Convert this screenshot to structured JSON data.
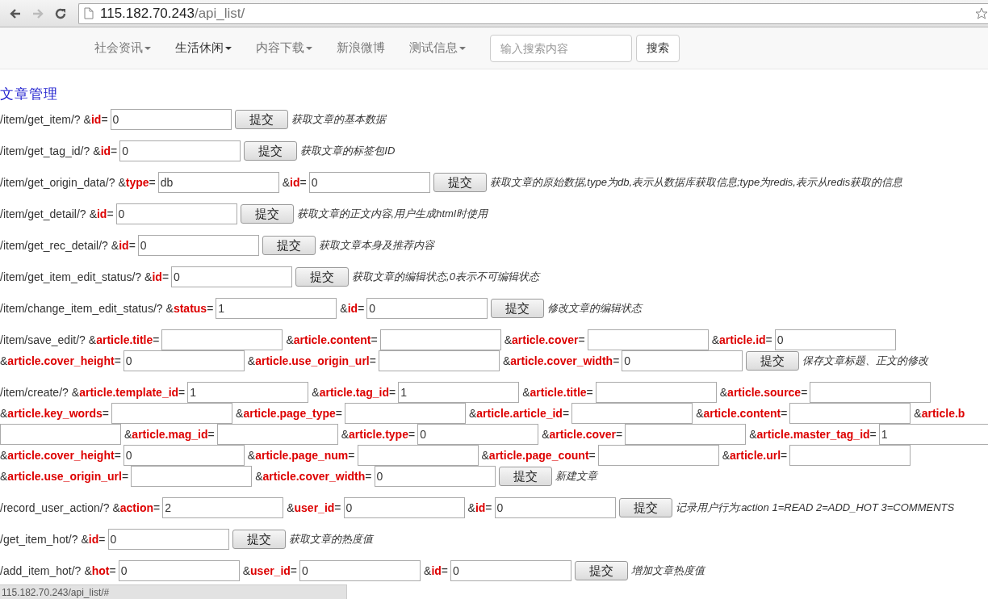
{
  "browser": {
    "url_host": "115.182.70.243",
    "url_path": "/api_list/",
    "status_text": "115.182.70.243/api_list/#"
  },
  "navbar": {
    "items": [
      {
        "label": "社会资讯",
        "dropdown": true,
        "selected": false
      },
      {
        "label": "生活休闲",
        "dropdown": true,
        "selected": true
      },
      {
        "label": "内容下载",
        "dropdown": true,
        "selected": false
      },
      {
        "label": "新浪微博",
        "dropdown": false,
        "selected": false
      },
      {
        "label": "测试信息",
        "dropdown": true,
        "selected": false
      }
    ],
    "search": {
      "placeholder": "输入搜索内容",
      "button": "搜索"
    }
  },
  "heading": "文章管理",
  "sections": [
    {
      "path": "/item/get_item/?",
      "params": [
        {
          "label": "&**id**=",
          "value": "0"
        }
      ],
      "button": "提交",
      "description": "获取文章的基本数据"
    },
    {
      "path": "/item/get_tag_id/?",
      "params": [
        {
          "label": "&**id**=",
          "value": "0"
        }
      ],
      "button": "提交",
      "description": "获取文章的标签包ID"
    },
    {
      "path": "/item/get_origin_data/?",
      "params": [
        {
          "label": "&**type**=",
          "value": "db"
        },
        {
          "label": "&**id**=",
          "value": "0"
        }
      ],
      "button": "提交",
      "description": "获取文章的原始数据,type为db,表示从数据库获取信息;type为redis,表示从redis获取的信息"
    },
    {
      "path": "/item/get_detail/?",
      "params": [
        {
          "label": "&**id**=",
          "value": "0"
        }
      ],
      "button": "提交",
      "description": "获取文章的正文内容,用户生成html时使用"
    },
    {
      "path": "/item/get_rec_detail/?",
      "params": [
        {
          "label": "&**id**=",
          "value": "0"
        }
      ],
      "button": "提交",
      "description": "获取文章本身及推荐内容"
    },
    {
      "path": "/item/get_item_edit_status/?",
      "params": [
        {
          "label": "&**id**=",
          "value": "0"
        }
      ],
      "button": "提交",
      "description": "获取文章的编辑状态,0表示不可编辑状态"
    },
    {
      "path": "/item/change_item_edit_status/?",
      "params": [
        {
          "label": "&**status**=",
          "value": "1"
        },
        {
          "label": "&**id**=",
          "value": "0"
        }
      ],
      "button": "提交",
      "description": "修改文章的编辑状态"
    },
    {
      "path": "/item/save_edit/?",
      "params": [
        {
          "label": "&**article.title**="
        },
        {
          "label": "&**article.content**="
        },
        {
          "label": "&**article.cover**="
        },
        {
          "label": "&**article.id**=",
          "value": "0"
        },
        {
          "label": "&**article.cover_height**=",
          "value": "0"
        },
        {
          "label": "&**article.use_origin_url**="
        },
        {
          "label": "&**article.cover_width**=",
          "value": "0"
        }
      ],
      "button": "提交",
      "description": "保存文章标题、正文的修改"
    },
    {
      "path": "/item/create/?",
      "params": [
        {
          "label": "&**article.template_id**=",
          "value": "1"
        },
        {
          "label": "&**article.tag_id**=",
          "value": "1"
        },
        {
          "label": "&**article.title**="
        },
        {
          "label": "&**article.source**="
        },
        {
          "label": "&**article.key_words**="
        },
        {
          "label": "&**article.page_type**="
        },
        {
          "label": "&**article.article_id**="
        },
        {
          "label": "&**article.content**="
        },
        {
          "label": "&**article.b**"
        },
        {
          "label": "&**article.mag_id**="
        },
        {
          "label": "&**article.type**=",
          "value": "0"
        },
        {
          "label": "&**article.cover**="
        },
        {
          "label": "&**article.master_tag_id**=",
          "value": "1"
        },
        {
          "label": "&**article.cover_height**=",
          "value": "0"
        },
        {
          "label": "&**article.page_num**="
        },
        {
          "label": "&**article.page_count**="
        },
        {
          "label": "&**article.url**="
        },
        {
          "label": "&**article.use_origin_url**="
        },
        {
          "label": "&**article.cover_width**=",
          "value": "0"
        }
      ],
      "button": "提交",
      "description": "新建文章"
    },
    {
      "path": "/record_user_action/?",
      "params": [
        {
          "label": "&**action**=",
          "value": "2"
        },
        {
          "label": "&**user_id**=",
          "value": "0"
        },
        {
          "label": "&**id**=",
          "value": "0"
        }
      ],
      "button": "提交",
      "description": "记录用户行为:action 1=READ 2=ADD_HOT 3=COMMENTS"
    },
    {
      "path": "/get_item_hot/?",
      "params": [
        {
          "label": "&**id**=",
          "value": "0"
        }
      ],
      "button": "提交",
      "description": "获取文章的热度值"
    },
    {
      "path": "/add_item_hot/?",
      "params": [
        {
          "label": "&**hot**=",
          "value": "0"
        },
        {
          "label": "&**user_id**=",
          "value": "0"
        },
        {
          "label": "&**id**=",
          "value": "0"
        }
      ],
      "button": "提交",
      "description": "增加文章热度值"
    }
  ]
}
